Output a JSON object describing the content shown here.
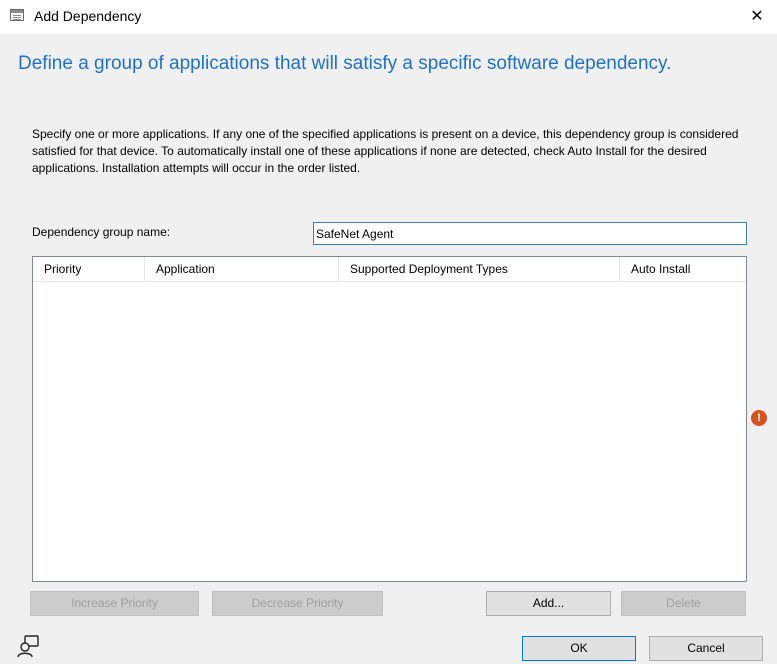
{
  "window": {
    "title": "Add Dependency",
    "close": "✕"
  },
  "heading": "Define a group of applications that will satisfy a specific software dependency.",
  "description": "Specify one or more applications. If any one of the specified applications is present on a device, this dependency group is considered satisfied for that device. To automatically install one of these applications if none are detected, check Auto Install for the desired applications. Installation attempts will occur in the order listed.",
  "group": {
    "label": "Dependency group name:",
    "value": "SafeNet Agent"
  },
  "columns": [
    "Priority",
    "Application",
    "Supported Deployment Types",
    "Auto Install"
  ],
  "warning_icon": "!",
  "buttons": {
    "increase_priority": "Increase Priority",
    "decrease_priority": "Decrease Priority",
    "add": "Add...",
    "delete": "Delete",
    "ok": "OK",
    "cancel": "Cancel"
  },
  "colors": {
    "heading": "#1e72c8",
    "accent": "#0078d7",
    "warning": "#d9531e"
  }
}
